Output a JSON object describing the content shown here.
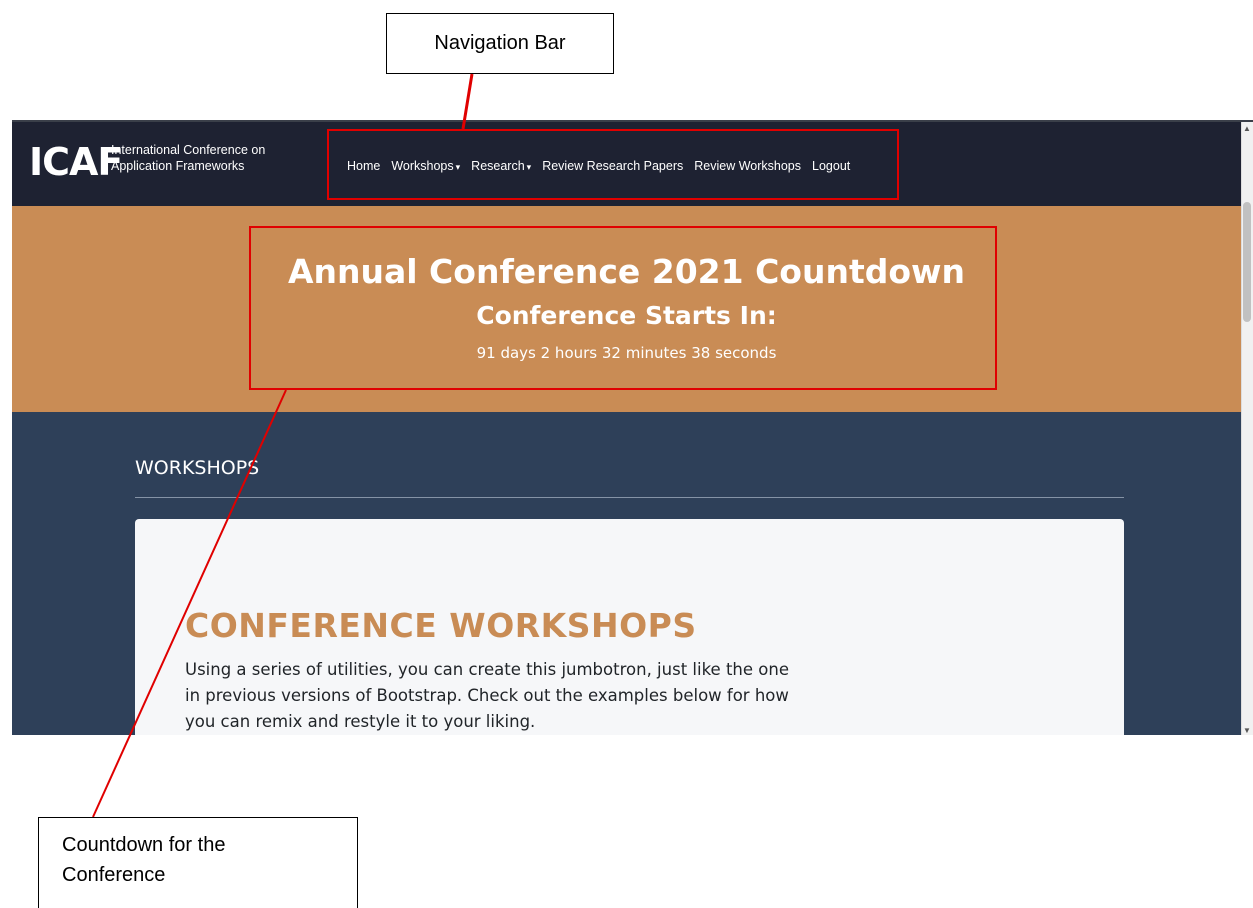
{
  "annotations": {
    "nav_label": "Navigation Bar",
    "countdown_label_line1": "Countdown for the",
    "countdown_label_line2": "Conference",
    "highlight_color": "#e00000"
  },
  "header": {
    "logo": "ICAF",
    "logo_subtitle_line1": "International Conference on",
    "logo_subtitle_line2": "Application Frameworks",
    "nav": {
      "home": "Home",
      "workshops": "Workshops",
      "research": "Research",
      "review_papers": "Review Research Papers",
      "review_workshops": "Review Workshops",
      "logout": "Logout"
    },
    "caret_icon": "▾"
  },
  "banner": {
    "title": "Annual Conference 2021 Countdown",
    "subtitle": "Conference Starts In:",
    "timer": "91 days 2 hours 32 minutes 38 seconds"
  },
  "workshops": {
    "section_title": "WORKSHOPS",
    "card_heading": "CONFERENCE WORKSHOPS",
    "card_text": "Using a series of utilities, you can create this jumbotron, just like the one in previous versions of Bootstrap. Check out the examples below for how you can remix and restyle it to your liking."
  },
  "colors": {
    "navbar": "#1e2232",
    "banner": "#c98c55",
    "page_bg": "#2e4059",
    "card_bg": "#f6f7f9",
    "accent": "#c98c55"
  }
}
